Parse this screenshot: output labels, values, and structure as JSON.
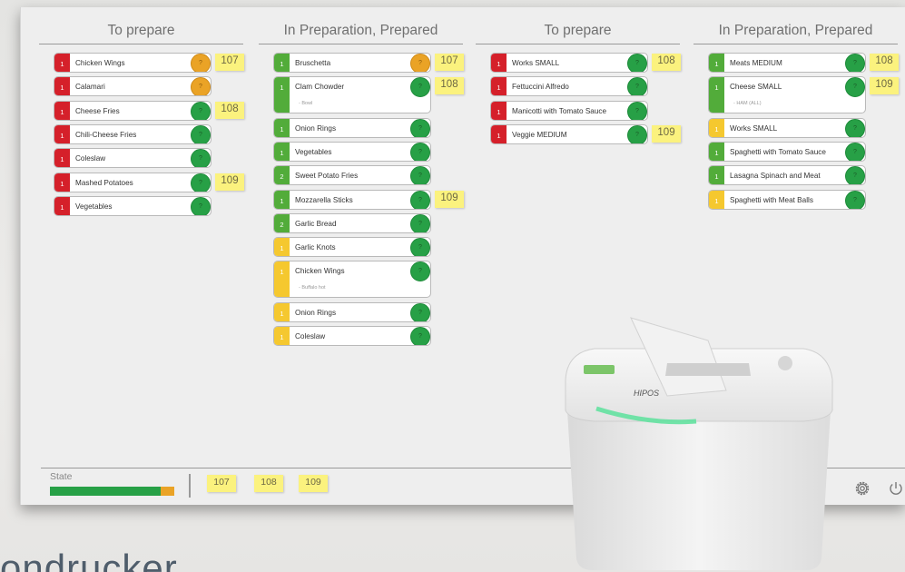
{
  "columns": [
    {
      "title": "To prepare",
      "tickets": [
        {
          "qty": "1",
          "qty_color": "red",
          "name": "Chicken Wings",
          "status": "orange",
          "sticky": "107"
        },
        {
          "qty": "1",
          "qty_color": "red",
          "name": "Calamari",
          "status": "orange",
          "sticky": ""
        },
        {
          "qty": "1",
          "qty_color": "red",
          "name": "Cheese Fries",
          "status": "green",
          "sticky": "108"
        },
        {
          "qty": "1",
          "qty_color": "red",
          "name": "Chili-Cheese Fries",
          "status": "green",
          "sticky": ""
        },
        {
          "qty": "1",
          "qty_color": "red",
          "name": "Coleslaw",
          "status": "green",
          "sticky": ""
        },
        {
          "qty": "1",
          "qty_color": "red",
          "name": "Mashed Potatoes",
          "status": "green",
          "sticky": "109"
        },
        {
          "qty": "1",
          "qty_color": "red",
          "name": "Vegetables",
          "status": "green",
          "sticky": ""
        }
      ]
    },
    {
      "title": "In Preparation, Prepared",
      "tickets": [
        {
          "qty": "1",
          "qty_color": "green",
          "name": "Bruschetta",
          "status": "orange",
          "sticky": "107"
        },
        {
          "qty": "1",
          "qty_color": "green",
          "name": "Clam Chowder",
          "note": "- Bowl",
          "status": "green",
          "sticky": "108"
        },
        {
          "qty": "1",
          "qty_color": "green",
          "name": "Onion Rings",
          "status": "green",
          "sticky": ""
        },
        {
          "qty": "1",
          "qty_color": "green",
          "name": "Vegetables",
          "status": "green",
          "sticky": ""
        },
        {
          "qty": "2",
          "qty_color": "green",
          "name": "Sweet Potato Fries",
          "status": "green",
          "sticky": ""
        },
        {
          "qty": "1",
          "qty_color": "green",
          "name": "Mozzarella Sticks",
          "status": "green",
          "sticky": "109"
        },
        {
          "qty": "2",
          "qty_color": "green",
          "name": "Garlic Bread",
          "status": "green",
          "sticky": ""
        },
        {
          "qty": "1",
          "qty_color": "yellow",
          "name": "Garlic Knots",
          "status": "green",
          "sticky": ""
        },
        {
          "qty": "1",
          "qty_color": "yellow",
          "name": "Chicken Wings",
          "note": "- Buffalo hot",
          "status": "green",
          "sticky": ""
        },
        {
          "qty": "1",
          "qty_color": "yellow",
          "name": "Onion Rings",
          "status": "green",
          "sticky": ""
        },
        {
          "qty": "1",
          "qty_color": "yellow",
          "name": "Coleslaw",
          "status": "green",
          "sticky": ""
        }
      ]
    },
    {
      "title": "To prepare",
      "tickets": [
        {
          "qty": "1",
          "qty_color": "red",
          "name": "Works SMALL",
          "status": "green",
          "sticky": "108"
        },
        {
          "qty": "1",
          "qty_color": "red",
          "name": "Fettuccini Alfredo",
          "status": "green",
          "sticky": ""
        },
        {
          "qty": "1",
          "qty_color": "red",
          "name": "Manicotti with Tomato Sauce",
          "status": "green",
          "sticky": ""
        },
        {
          "qty": "1",
          "qty_color": "red",
          "name": "Veggie MEDIUM",
          "status": "green",
          "sticky": "109"
        }
      ]
    },
    {
      "title": "In Preparation, Prepared",
      "tickets": [
        {
          "qty": "1",
          "qty_color": "green",
          "name": "Meats MEDIUM",
          "status": "green",
          "sticky": "108"
        },
        {
          "qty": "1",
          "qty_color": "green",
          "name": "Cheese SMALL",
          "note": "- HAM (ALL)",
          "status": "green",
          "sticky": "109"
        },
        {
          "qty": "1",
          "qty_color": "yellow",
          "name": "Works SMALL",
          "status": "green",
          "sticky": ""
        },
        {
          "qty": "1",
          "qty_color": "green",
          "name": "Spaghetti  with Tomato Sauce",
          "status": "green",
          "sticky": ""
        },
        {
          "qty": "1",
          "qty_color": "green",
          "name": "Lasagna Spinach and Meat",
          "status": "green",
          "sticky": ""
        },
        {
          "qty": "1",
          "qty_color": "yellow",
          "name": "Spaghetti with Meat Balls",
          "status": "green",
          "sticky": ""
        }
      ]
    }
  ],
  "footer": {
    "state_label": "State",
    "state_progress": {
      "green": 0.89,
      "orange": 0.11
    },
    "orders": [
      "107",
      "108",
      "109"
    ]
  },
  "printer_brand": "HIPOS",
  "bottom_text": "ondrucker",
  "colors": {
    "red": "#d5202a",
    "green": "#52ac3a",
    "yellow": "#f5c82f",
    "status_green": "#27a046",
    "status_orange": "#eaa326",
    "sticky": "#fbf27e"
  }
}
